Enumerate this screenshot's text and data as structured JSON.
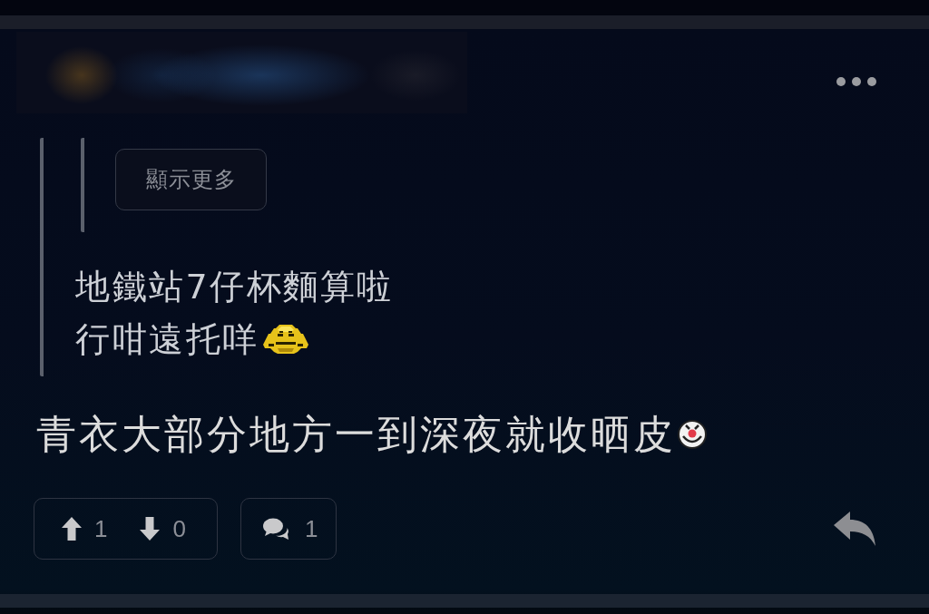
{
  "quote": {
    "show_more_button": "顯示更多",
    "lines": [
      "地鐵站7仔杯麵算啦",
      "行咁遠托咩"
    ]
  },
  "post": {
    "text": "青衣大部分地方一到深夜就收晒皮"
  },
  "actions": {
    "upvotes": "1",
    "downvotes": "0",
    "replies": "1"
  }
}
